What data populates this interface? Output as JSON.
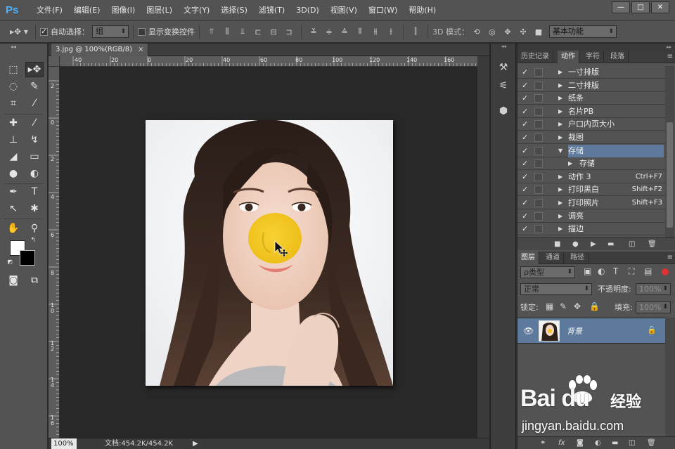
{
  "app": {
    "logo": "Ps",
    "menus": [
      "文件(F)",
      "编辑(E)",
      "图像(I)",
      "图层(L)",
      "文字(Y)",
      "选择(S)",
      "滤镜(T)",
      "3D(D)",
      "视图(V)",
      "窗口(W)",
      "帮助(H)"
    ],
    "window_controls": [
      "—",
      "□",
      "✕"
    ]
  },
  "options": {
    "auto_select_label": "自动选择：",
    "auto_select_checked": true,
    "auto_select_value": "组",
    "show_transform_label": "显示变换控件",
    "show_transform_checked": false,
    "mode_3d_label": "3D 模式：",
    "workspace_value": "基本功能"
  },
  "document": {
    "tab_title": "3.jpg @ 100%(RGB/8)",
    "tab_close": "×",
    "ruler_top": [
      "40",
      "20",
      "0",
      "20",
      "40",
      "60",
      "80",
      "100",
      "120",
      "140",
      "160"
    ],
    "ruler_left": [
      "2",
      "0",
      "2",
      "4",
      "6",
      "8",
      "10",
      "12",
      "14",
      "16"
    ],
    "zoom": "100%",
    "doc_info": "文档:454.2K/454.2K",
    "status_arrow": "▶"
  },
  "actions_panel": {
    "tabs": [
      "历史记录",
      "动作",
      "字符",
      "段落"
    ],
    "active_tab": "动作",
    "menu_icon": "≡",
    "items": [
      {
        "name": "一寸排版",
        "shortcut": "",
        "expanded": false,
        "indent": 0,
        "selected": false
      },
      {
        "name": "二寸排版",
        "shortcut": "",
        "expanded": false,
        "indent": 0,
        "selected": false
      },
      {
        "name": "纸条",
        "shortcut": "",
        "expanded": false,
        "indent": 0,
        "selected": false
      },
      {
        "name": "名片PB",
        "shortcut": "",
        "expanded": false,
        "indent": 0,
        "selected": false
      },
      {
        "name": "户口内页大小",
        "shortcut": "",
        "expanded": false,
        "indent": 0,
        "selected": false
      },
      {
        "name": "裁图",
        "shortcut": "",
        "expanded": false,
        "indent": 0,
        "selected": false
      },
      {
        "name": "存储",
        "shortcut": "",
        "expanded": true,
        "indent": 0,
        "selected": true
      },
      {
        "name": "存储",
        "shortcut": "",
        "expanded": false,
        "indent": 1,
        "selected": false
      },
      {
        "name": "动作 3",
        "shortcut": "Ctrl+F7",
        "expanded": false,
        "indent": 0,
        "selected": false
      },
      {
        "name": "打印黑白",
        "shortcut": "Shift+F2",
        "expanded": false,
        "indent": 0,
        "selected": false
      },
      {
        "name": "打印照片",
        "shortcut": "Shift+F3",
        "expanded": false,
        "indent": 0,
        "selected": false
      },
      {
        "name": "调亮",
        "shortcut": "",
        "expanded": false,
        "indent": 0,
        "selected": false
      },
      {
        "name": "描边",
        "shortcut": "",
        "expanded": false,
        "indent": 0,
        "selected": false
      }
    ]
  },
  "layers_panel": {
    "tabs": [
      "图层",
      "通道",
      "路径"
    ],
    "active_tab": "图层",
    "menu_icon": "≡",
    "filter_value": "ρ类型",
    "blend_mode": "正常",
    "opacity_label": "不透明度:",
    "opacity_value": "100%",
    "lock_label": "锁定:",
    "fill_label": "填充:",
    "fill_value": "100%",
    "layers": [
      {
        "name": "背景",
        "visible": true,
        "locked": true
      }
    ]
  },
  "watermark": {
    "brand": "Bai du",
    "chinese": "经验",
    "url": "jingyan.baidu.com"
  },
  "colors": {
    "accent_selection": "#5d7a9c",
    "panel_bg": "#535353",
    "canvas_bg": "#282828",
    "yellow_blob": "#f3c91d",
    "ps_logo": "#4fb3ff"
  }
}
